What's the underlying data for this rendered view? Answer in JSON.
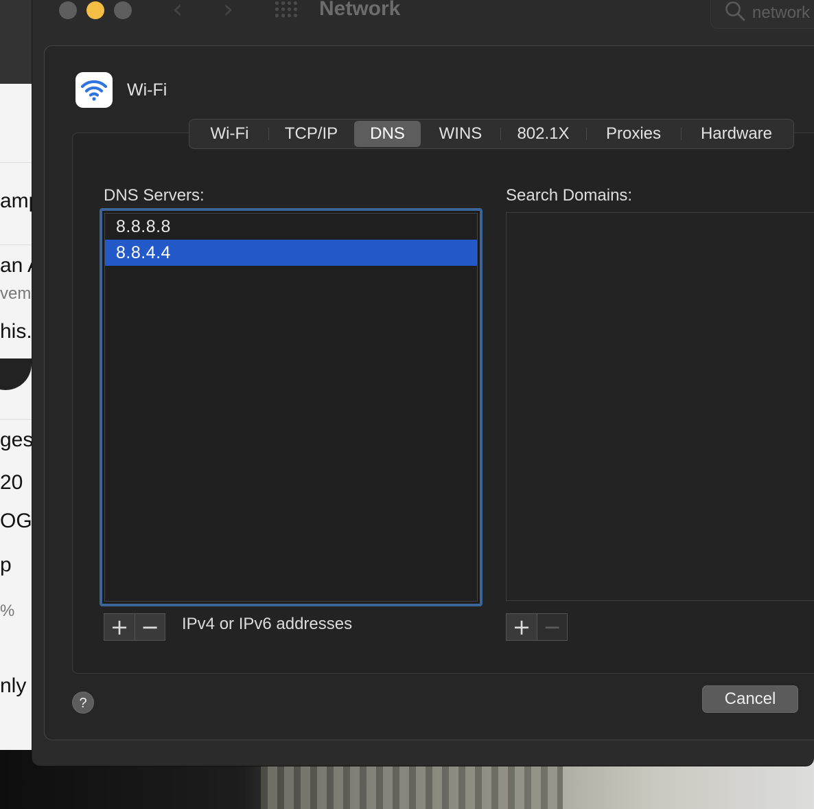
{
  "background_page": {
    "fragments": [
      "amp",
      "an A",
      "vem",
      "his.",
      "ges",
      "20",
      "OG",
      "p",
      "%",
      "nly"
    ]
  },
  "window": {
    "title": "Network",
    "search": {
      "value": "network"
    }
  },
  "sheet": {
    "interface_name": "Wi-Fi",
    "tabs": [
      {
        "label": "Wi-Fi"
      },
      {
        "label": "TCP/IP"
      },
      {
        "label": "DNS"
      },
      {
        "label": "WINS"
      },
      {
        "label": "802.1X"
      },
      {
        "label": "Proxies"
      },
      {
        "label": "Hardware"
      }
    ],
    "active_tab": "DNS",
    "dns_servers": {
      "label": "DNS Servers:",
      "entries": [
        "8.8.8.8",
        "8.8.4.4"
      ],
      "selected": "8.8.4.4",
      "hint": "IPv4 or IPv6 addresses"
    },
    "search_domains": {
      "label": "Search Domains:",
      "entries": []
    },
    "buttons": {
      "add": "+",
      "remove": "−",
      "help": "?",
      "cancel": "Cancel"
    }
  },
  "colors": {
    "selection": "#2459c9",
    "focus_ring": "#3a6596",
    "wifi_icon": "#2f74e0",
    "minimize_light": "#f4bd43"
  }
}
